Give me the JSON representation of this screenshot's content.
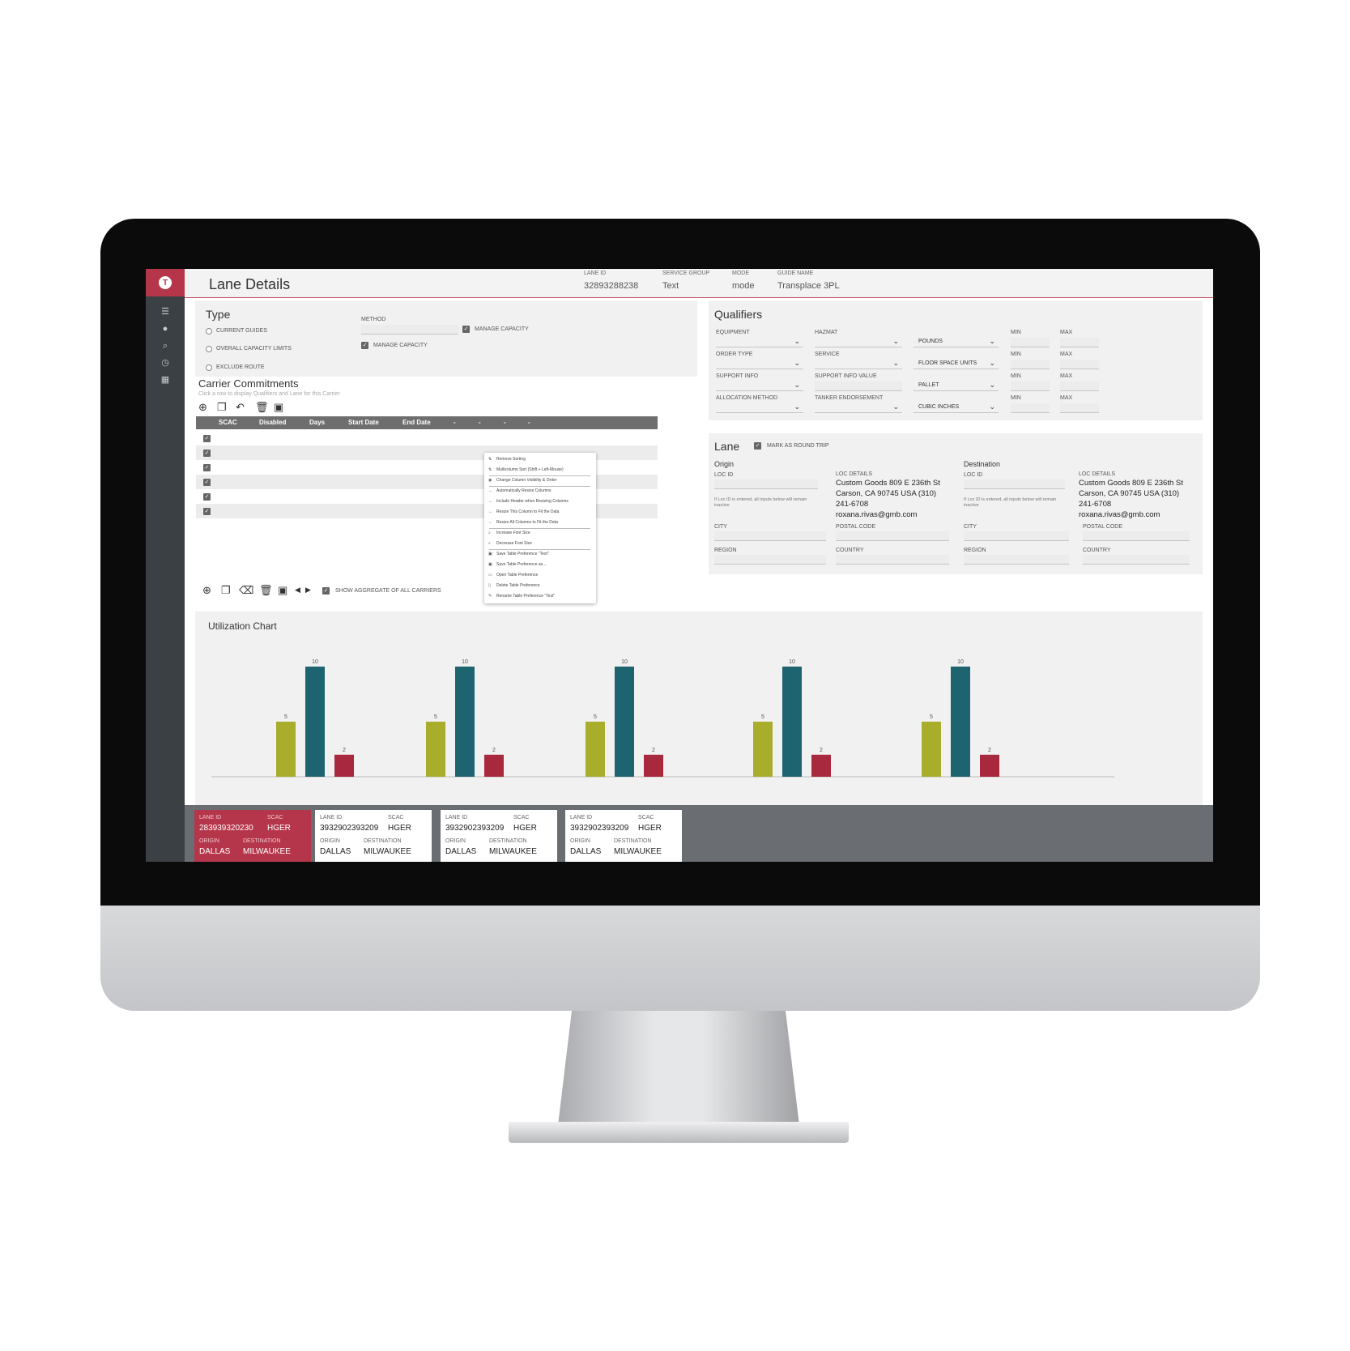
{
  "header": {
    "title": "Lane Details",
    "lane_id_label": "LANE ID",
    "lane_id": "32893288238",
    "service_group_label": "SERVICE GROUP",
    "service_group": "Text",
    "mode_label": "MODE",
    "mode": "mode",
    "guide_name_label": "GUIDE NAME",
    "guide_name": "Transplace 3PL"
  },
  "sidebar": {
    "items": [
      "menu-icon",
      "user-icon",
      "search-icon",
      "clock-icon",
      "dashboard-icon"
    ]
  },
  "type_panel": {
    "title": "Type",
    "radios": [
      "CURRENT GUIDES",
      "OVERALL CAPACITY LIMITS",
      "EXCLUDE ROUTE"
    ],
    "method_label": "METHOD",
    "manage_capacity_1": "MANAGE CAPACITY",
    "manage_capacity_2": "MANAGE CAPACITY"
  },
  "carrier": {
    "title": "Carrier Commitments",
    "subtitle": "Click a row to display Qualifiers and Lane for this Carrier",
    "columns": [
      "SCAC",
      "Disabled",
      "Days",
      "Start Date",
      "End Date",
      "-",
      "-",
      "-",
      "-"
    ],
    "row_count": 6,
    "show_aggregate": "SHOW AGGREGATE OF ALL CARRIERS"
  },
  "context_menu": {
    "items": [
      "Remove Sorting",
      "Multicolumn Sort (Shift + Left-Mouse)",
      "Change Column Visibility & Order",
      "Automatically Resize Columns",
      "Include Header when Resizing Columns",
      "Resize This Column to Fit the Data",
      "Resize All Columns to Fit the Data",
      "Increase Font Size",
      "Decrease Font Size",
      "Save Table Preference \"Test\"",
      "Save Table Preference as...",
      "Open Table Preference",
      "Delete Table Preference",
      "Rename Table Preference \"Test\""
    ]
  },
  "qualifiers": {
    "title": "Qualifiers",
    "labels": {
      "equipment": "EQUIPMENT",
      "hazmat": "HAZMAT",
      "order_type": "ORDER TYPE",
      "service": "SERVICE",
      "support_info": "SUPPORT INFO",
      "support_info_value": "SUPPORT INFO VALUE",
      "allocation_method": "ALLOCATION METHOD",
      "tanker_endorsement": "TANKER ENDORSEMENT",
      "min": "MIN",
      "max": "MAX"
    },
    "units": [
      "POUNDS",
      "FLOOR SPACE UNITS",
      "PALLET",
      "CUBIC INCHES"
    ]
  },
  "lane": {
    "title": "Lane",
    "round_trip": "MARK AS ROUND TRIP",
    "origin_title": "Origin",
    "destination_title": "Destination",
    "loc_id": "LOC ID",
    "loc_details": "LOC DETAILS",
    "note": "If Loc ID is entered, all inputs below will remain inactive",
    "address": "Custom Goods 809 E 236th St Carson, CA 90745 USA (310) 241-6708 roxana.rivas@gmb.com",
    "city": "CITY",
    "postal_code": "POSTAL CODE",
    "region": "REGION",
    "country": "COUNTRY"
  },
  "chart_title": "Utilization Chart",
  "chart_data": {
    "type": "bar",
    "categories": [
      "",
      "",
      "",
      "",
      ""
    ],
    "series": [
      {
        "values": [
          5,
          5,
          5,
          5,
          5
        ],
        "color": "#a8ad2b"
      },
      {
        "values": [
          10,
          10,
          10,
          10,
          10
        ],
        "color": "#1e6470"
      },
      {
        "values": [
          2,
          2,
          2,
          2,
          2
        ],
        "color": "#a8293d"
      }
    ],
    "ylim": [
      0,
      10
    ],
    "grid": false
  },
  "cards": [
    {
      "lane_id_label": "LANE ID",
      "lane_id": "283939320230",
      "scac_label": "SCAC",
      "scac": "HGER",
      "origin_label": "ORIGIN",
      "origin": "DALLAS",
      "destination_label": "DESTINATION",
      "destination": "MILWAUKEE"
    },
    {
      "lane_id_label": "LANE ID",
      "lane_id": "3932902393209",
      "scac_label": "SCAC",
      "scac": "HGER",
      "origin_label": "ORIGIN",
      "origin": "DALLAS",
      "destination_label": "DESTINATION",
      "destination": "MILWAUKEE"
    },
    {
      "lane_id_label": "LANE ID",
      "lane_id": "3932902393209",
      "scac_label": "SCAC",
      "scac": "HGER",
      "origin_label": "ORIGIN",
      "origin": "DALLAS",
      "destination_label": "DESTINATION",
      "destination": "MILWAUKEE"
    },
    {
      "lane_id_label": "LANE ID",
      "lane_id": "3932902393209",
      "scac_label": "SCAC",
      "scac": "HGER",
      "origin_label": "ORIGIN",
      "origin": "DALLAS",
      "destination_label": "DESTINATION",
      "destination": "MILWAUKEE"
    }
  ],
  "colors": {
    "brand": "#b5364a",
    "sidebar": "#3b4045"
  }
}
